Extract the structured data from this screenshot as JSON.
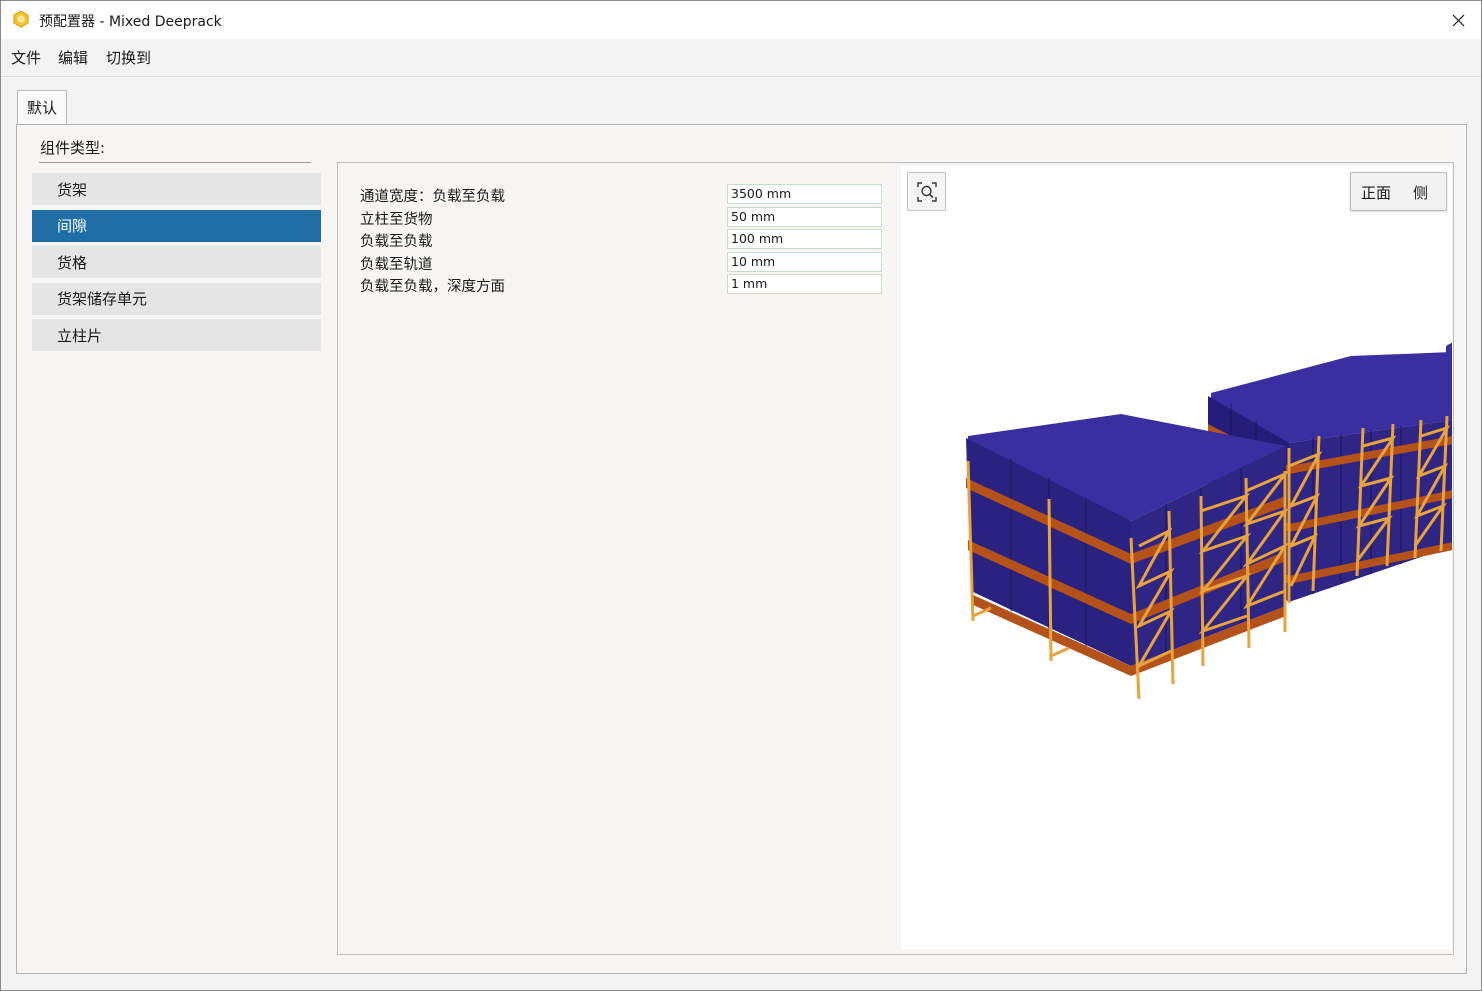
{
  "window": {
    "title": "预配置器 - Mixed Deeprack",
    "app_icon": "hexagon-app-icon",
    "close_icon": "close-icon"
  },
  "menu": [
    "文件",
    "编辑",
    "切换到"
  ],
  "tabs": [
    {
      "label": "默认"
    }
  ],
  "component_panel": {
    "label": "组件类型:",
    "items": [
      {
        "label": "货架",
        "selected": false
      },
      {
        "label": "间隙",
        "selected": true
      },
      {
        "label": "货格",
        "selected": false
      },
      {
        "label": "货架储存单元",
        "selected": false
      },
      {
        "label": "立柱片",
        "selected": false
      }
    ]
  },
  "parameters": [
    {
      "label": "通道宽度：负载至负载",
      "value": "3500 mm"
    },
    {
      "label": "立柱至货物",
      "value": "50 mm"
    },
    {
      "label": "负载至负载",
      "value": "100 mm"
    },
    {
      "label": "负载至轨道",
      "value": "10 mm"
    },
    {
      "label": "负载至负载，深度方面",
      "value": "1 mm"
    }
  ],
  "viewport": {
    "zoom_icon": "zoom-extents-icon",
    "view_buttons": [
      "正面",
      "侧"
    ]
  },
  "colors": {
    "selection": "#1f6ea5",
    "load": "#2e2585",
    "beam": "#b5521a",
    "upright": "#e8a33d"
  }
}
